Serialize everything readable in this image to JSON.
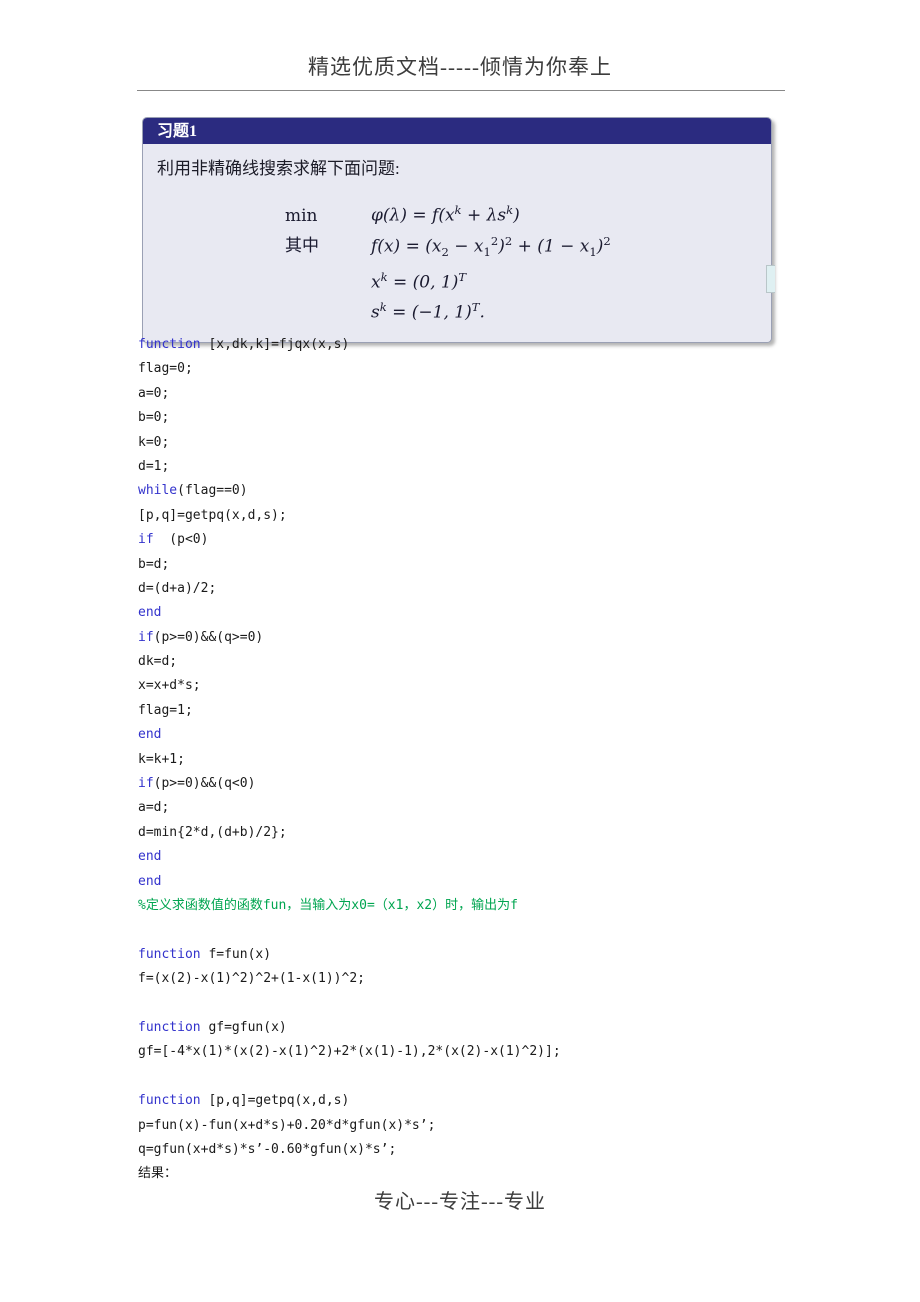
{
  "page": {
    "header_text": "精选优质文档-----倾情为你奉上",
    "footer_text": "专心---专注---专业",
    "background_color": "#ffffff",
    "rule_color": "#888888"
  },
  "exercise_box": {
    "title": "习题1",
    "title_bar_color": "#2b2b80",
    "body_color": "#e8e9f2",
    "prompt": "利用非精确线搜索求解下面问题:",
    "math": [
      {
        "label": "min",
        "expr_html": "<i>φ</i>(<i>λ</i>) = <i>f</i>(<i>x</i><sup>k</sup> + <i>λ</i><i>s</i><sup>k</sup>)",
        "expr_text": "φ(λ) = f(x^k + λs^k)"
      },
      {
        "label": "其中",
        "expr_html": "<i>f</i>(<i>x</i>) = (<i>x</i><sub class=\"rm\">2</sub> − <i>x</i><sub class=\"rm\">1</sub><sup class=\"rm\">2</sup>)<sup class=\"rm\">2</sup> + (1 − <i>x</i><sub class=\"rm\">1</sub>)<sup class=\"rm\">2</sup>",
        "expr_text": "f(x) = (x2 − x1^2)^2 + (1 − x1)^2"
      },
      {
        "label": "",
        "expr_html": "<i>x</i><sup>k</sup> = (0, 1)<sup><i>T</i></sup>",
        "expr_text": "x^k = (0,1)^T"
      },
      {
        "label": "",
        "expr_html": "<i>s</i><sup>k</sup> = (−1, 1)<sup><i>T</i></sup>.",
        "expr_text": "s^k = (−1,1)^T."
      }
    ]
  },
  "code": {
    "keyword_color": "#3333cc",
    "comment_color": "#00a550",
    "text_color": "#1a1a1a",
    "lines": [
      {
        "type": "mixed",
        "kw": "function",
        "rest": " [x,dk,k]=fjqx(x,s)"
      },
      {
        "type": "plain",
        "text": "flag=0;"
      },
      {
        "type": "plain",
        "text": "a=0;"
      },
      {
        "type": "plain",
        "text": "b=0;"
      },
      {
        "type": "plain",
        "text": "k=0;"
      },
      {
        "type": "plain",
        "text": "d=1;"
      },
      {
        "type": "mixed",
        "kw": "while",
        "rest": "(flag==0)"
      },
      {
        "type": "plain",
        "text": "[p,q]=getpq(x,d,s);"
      },
      {
        "type": "mixed",
        "kw": "if",
        "rest": "  (p<0)"
      },
      {
        "type": "plain",
        "text": "b=d;"
      },
      {
        "type": "plain",
        "text": "d=(d+a)/2;"
      },
      {
        "type": "keyword",
        "text": "end"
      },
      {
        "type": "mixed",
        "kw": "if",
        "rest": "(p>=0)&&(q>=0)"
      },
      {
        "type": "plain",
        "text": "dk=d;"
      },
      {
        "type": "plain",
        "text": "x=x+d*s;"
      },
      {
        "type": "plain",
        "text": "flag=1;"
      },
      {
        "type": "keyword",
        "text": "end"
      },
      {
        "type": "plain",
        "text": "k=k+1;"
      },
      {
        "type": "mixed",
        "kw": "if",
        "rest": "(p>=0)&&(q<0)"
      },
      {
        "type": "plain",
        "text": "a=d;"
      },
      {
        "type": "plain",
        "text": "d=min{2*d,(d+b)/2};"
      },
      {
        "type": "keyword",
        "text": "end"
      },
      {
        "type": "keyword",
        "text": "end"
      },
      {
        "type": "comment",
        "text": "%定义求函数值的函数fun，当输入为x0=（x1，x2）时，输出为f"
      },
      {
        "type": "blank",
        "text": ""
      },
      {
        "type": "mixed",
        "kw": "function",
        "rest": " f=fun(x)"
      },
      {
        "type": "plain",
        "text": "f=(x(2)-x(1)^2)^2+(1-x(1))^2;"
      },
      {
        "type": "blank",
        "text": ""
      },
      {
        "type": "mixed",
        "kw": "function",
        "rest": " gf=gfun(x)"
      },
      {
        "type": "plain",
        "text": "gf=[-4*x(1)*(x(2)-x(1)^2)+2*(x(1)-1),2*(x(2)-x(1)^2)];"
      },
      {
        "type": "blank",
        "text": ""
      },
      {
        "type": "mixed",
        "kw": "function",
        "rest": " [p,q]=getpq(x,d,s)"
      },
      {
        "type": "plain",
        "text": "p=fun(x)-fun(x+d*s)+0.20*d*gfun(x)*s’;"
      },
      {
        "type": "plain",
        "text": "q=gfun(x+d*s)*s’-0.60*gfun(x)*s’;"
      },
      {
        "type": "plain",
        "text": "结果："
      }
    ]
  }
}
